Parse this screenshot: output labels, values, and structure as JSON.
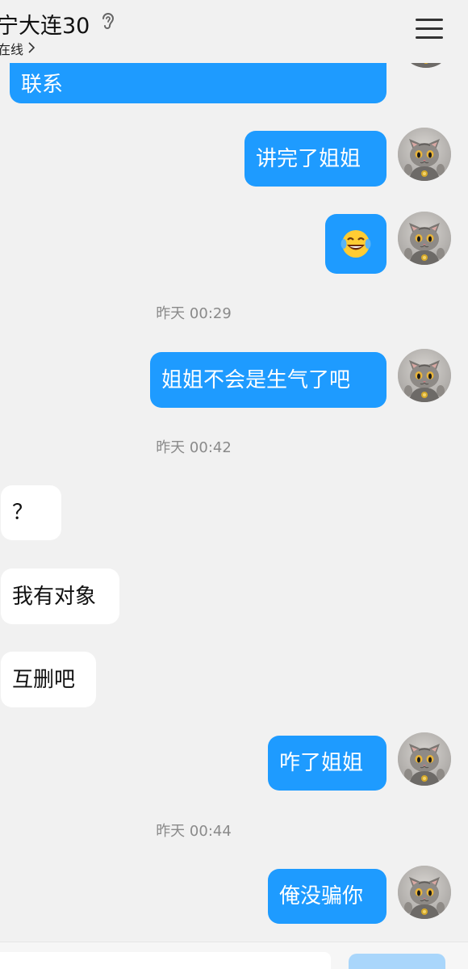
{
  "header": {
    "title": "宁大连30",
    "status": "在线",
    "ear_icon": "ear-icon",
    "menu_icon": "menu-icon"
  },
  "messages": [
    {
      "side": "out",
      "text": "联系"
    },
    {
      "side": "out",
      "text": "讲完了姐姐"
    },
    {
      "side": "out",
      "emoji": "😂",
      "icon": "tears-of-joy-emoji"
    },
    {
      "type": "timestamp",
      "text": "昨天 00:29"
    },
    {
      "side": "out",
      "text": "姐姐不会是生气了吧"
    },
    {
      "type": "timestamp",
      "text": "昨天 00:42"
    },
    {
      "side": "in",
      "text": "？"
    },
    {
      "side": "in",
      "text": "我有对象"
    },
    {
      "side": "in",
      "text": "互删吧"
    },
    {
      "side": "out",
      "text": "咋了姐姐"
    },
    {
      "type": "timestamp",
      "text": "昨天 00:44"
    },
    {
      "side": "out",
      "text": "俺没骗你"
    }
  ],
  "colors": {
    "background": "#f1f1f1",
    "outgoing_bubble": "#1e9bff",
    "incoming_bubble": "#ffffff",
    "timestamp_text": "#8a8a8a",
    "send_button": "#a9d6fb"
  }
}
